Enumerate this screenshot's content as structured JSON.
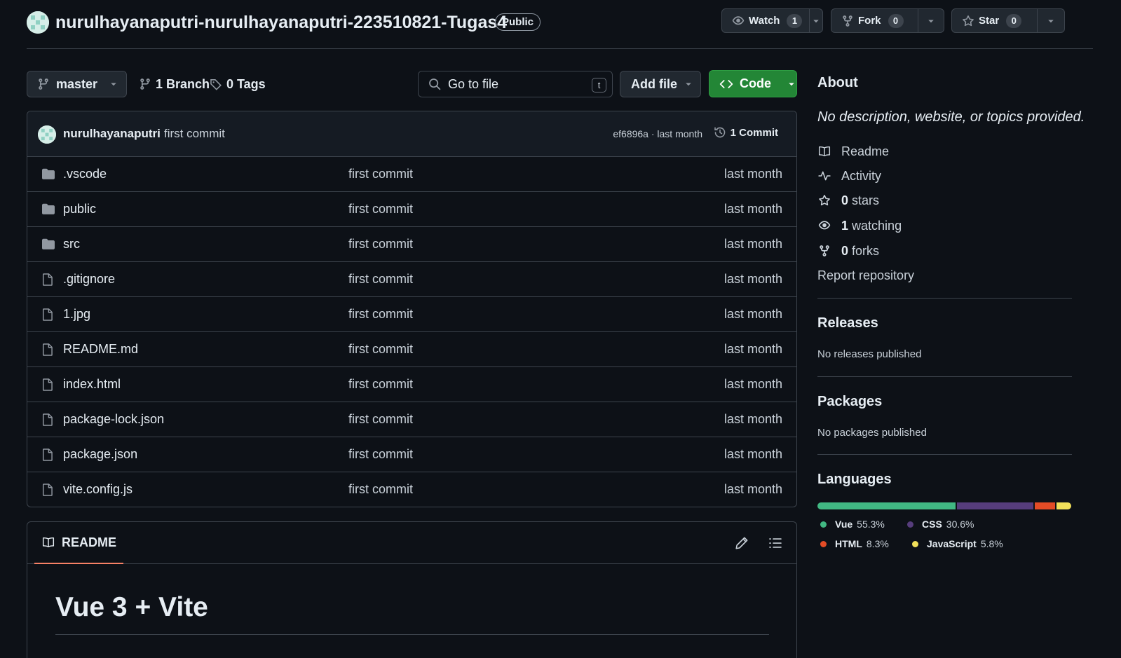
{
  "repo": {
    "title": "nurulhayanaputri-nurulhayanaputri-223510821-Tugas4",
    "visibility": "Public",
    "watch_label": "Watch",
    "watch_count": "1",
    "fork_label": "Fork",
    "fork_count": "0",
    "star_label": "Star",
    "star_count": "0"
  },
  "toolbar": {
    "branch": "master",
    "branches": "1 Branch",
    "tags": "0 Tags",
    "search_placeholder": "Go to file",
    "search_shortcut": "t",
    "add_file": "Add file",
    "code": "Code"
  },
  "latest_commit": {
    "user": "nurulhayanaputri",
    "message": "first commit",
    "hash_time": "ef6896a · last month",
    "count": "1 Commit"
  },
  "files": [
    {
      "name": ".vscode",
      "type": "folder",
      "message": "first commit",
      "date": "last month"
    },
    {
      "name": "public",
      "type": "folder",
      "message": "first commit",
      "date": "last month"
    },
    {
      "name": "src",
      "type": "folder",
      "message": "first commit",
      "date": "last month"
    },
    {
      "name": ".gitignore",
      "type": "file",
      "message": "first commit",
      "date": "last month"
    },
    {
      "name": "1.jpg",
      "type": "file",
      "message": "first commit",
      "date": "last month"
    },
    {
      "name": "README.md",
      "type": "file",
      "message": "first commit",
      "date": "last month"
    },
    {
      "name": "index.html",
      "type": "file",
      "message": "first commit",
      "date": "last month"
    },
    {
      "name": "package-lock.json",
      "type": "file",
      "message": "first commit",
      "date": "last month"
    },
    {
      "name": "package.json",
      "type": "file",
      "message": "first commit",
      "date": "last month"
    },
    {
      "name": "vite.config.js",
      "type": "file",
      "message": "first commit",
      "date": "last month"
    }
  ],
  "readme": {
    "tab": "README",
    "heading": "Vue 3 + Vite"
  },
  "about": {
    "heading": "About",
    "description": "No description, website, or topics provided.",
    "readme": "Readme",
    "activity": "Activity",
    "stars_count": "0",
    "stars_label": "stars",
    "watching_count": "1",
    "watching_label": "watching",
    "forks_count": "0",
    "forks_label": "forks",
    "report": "Report repository"
  },
  "releases": {
    "heading": "Releases",
    "text": "No releases published"
  },
  "packages": {
    "heading": "Packages",
    "text": "No packages published"
  },
  "languages": {
    "heading": "Languages",
    "items": [
      {
        "name": "Vue",
        "percent": "55.3%",
        "value": 55.3,
        "color": "#41b883"
      },
      {
        "name": "CSS",
        "percent": "30.6%",
        "value": 30.6,
        "color": "#563d7c"
      },
      {
        "name": "HTML",
        "percent": "8.3%",
        "value": 8.3,
        "color": "#e34c26"
      },
      {
        "name": "JavaScript",
        "percent": "5.8%",
        "value": 5.8,
        "color": "#f1e05a"
      }
    ]
  }
}
